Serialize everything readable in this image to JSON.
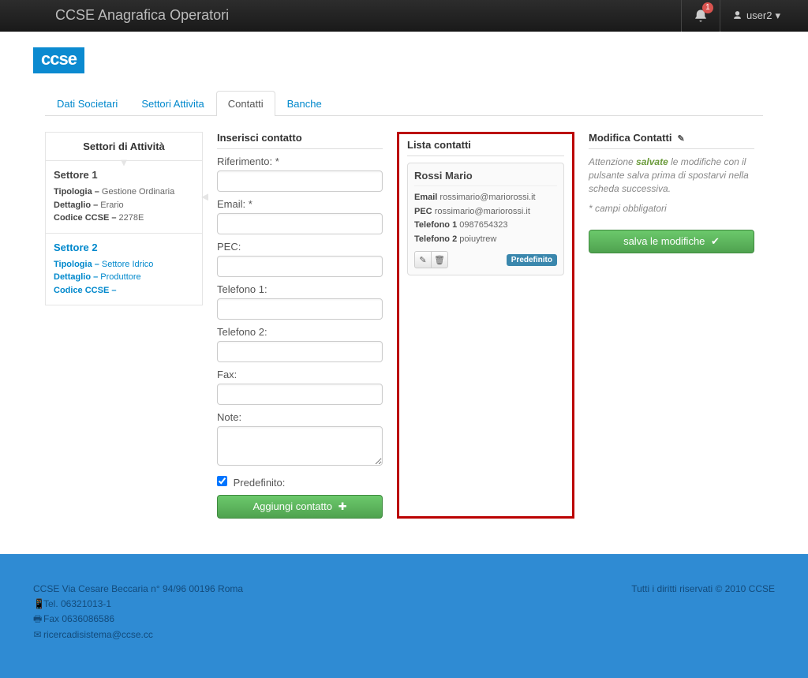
{
  "navbar": {
    "brand": "CCSE Anagrafica Operatori",
    "notif_count": "1",
    "user": "user2"
  },
  "logo": "ccse",
  "tabs": [
    "Dati Societari",
    "Settori Attivita",
    "Contatti",
    "Banche"
  ],
  "active_tab": 2,
  "sectors": {
    "title": "Settori di Attività",
    "items": [
      {
        "name": "Settore 1",
        "tip_label": "Tipologia –",
        "tip": "Gestione Ordinaria",
        "det_label": "Dettaglio –",
        "det": "Erario",
        "cod_label": "Codice CCSE –",
        "cod": "2278E",
        "selected": false
      },
      {
        "name": "Settore 2",
        "tip_label": "Tipologia –",
        "tip": "Settore Idrico",
        "det_label": "Dettaglio –",
        "det": "Produttore",
        "cod_label": "Codice CCSE –",
        "cod": "",
        "selected": true
      }
    ]
  },
  "form": {
    "title": "Inserisci contatto",
    "rif_label": "Riferimento: *",
    "email_label": "Email: *",
    "pec_label": "PEC:",
    "tel1_label": "Telefono 1:",
    "tel2_label": "Telefono 2:",
    "fax_label": "Fax:",
    "note_label": "Note:",
    "pred_label": "Predefinito:",
    "add_button": "Aggiungi contatto"
  },
  "list": {
    "title": "Lista contatti",
    "contact": {
      "name": "Rossi Mario",
      "email_label": "Email",
      "email": "rossimario@mariorossi.it",
      "pec_label": "PEC",
      "pec": "rossimario@mariorossi.it",
      "tel1_label": "Telefono 1",
      "tel1": "0987654323",
      "tel2_label": "Telefono 2",
      "tel2": "poiuytrew",
      "badge": "Predefinito"
    }
  },
  "modify": {
    "title": "Modifica Contatti",
    "note_pre": "Attenzione ",
    "note_bold": "salvate",
    "note_post": " le modifiche con il pulsante salva prima di spostarvi nella scheda successiva.",
    "req": "* campi obbligatori",
    "save": "salva le modifiche"
  },
  "footer": {
    "addr": "CCSE Via Cesare Beccaria n° 94/96 00196 Roma",
    "tel": "Tel. 06321013-1",
    "fax": "Fax 0636086586",
    "email": "ricercadisistema@ccse.cc",
    "copy": "Tutti i diritti riservati © 2010 CCSE"
  }
}
